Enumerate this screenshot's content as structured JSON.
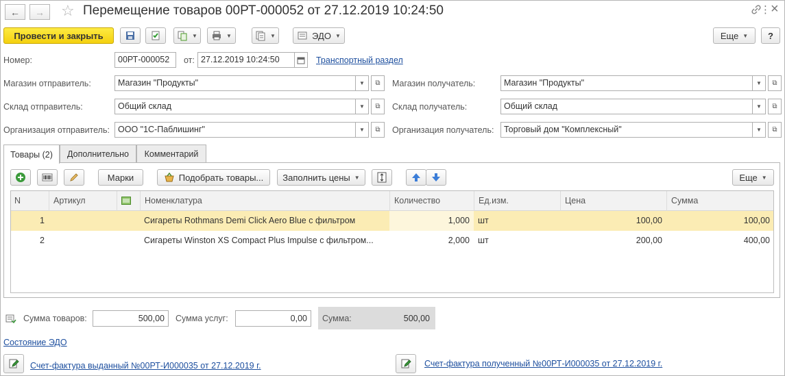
{
  "window": {
    "title": "Перемещение товаров 00РТ-000052 от 27.12.2019 10:24:50",
    "back_glyph": "←",
    "forward_glyph": "→",
    "star_glyph": "☆",
    "link_glyph": "🔗",
    "menu_glyph": "⋮",
    "close_glyph": "×"
  },
  "toolbar": {
    "post_close_label": "Провести и закрыть",
    "edo_label": "ЭДО",
    "more_label": "Еще",
    "help_label": "?"
  },
  "form": {
    "number_label": "Номер:",
    "number_value": "00РТ-000052",
    "date_label": "от:",
    "date_value": "27.12.2019 10:24:50",
    "transport_link": "Транспортный раздел",
    "store_sender_label": "Магазин отправитель:",
    "store_sender_value": "Магазин \"Продукты\"",
    "store_receiver_label": "Магазин получатель:",
    "store_receiver_value": "Магазин \"Продукты\"",
    "warehouse_sender_label": "Склад отправитель:",
    "warehouse_sender_value": "Общий склад",
    "warehouse_receiver_label": "Склад получатель:",
    "warehouse_receiver_value": "Общий склад",
    "org_sender_label": "Организация отправитель:",
    "org_sender_value": "ООО \"1С-Паблишинг\"",
    "org_receiver_label": "Организация получатель:",
    "org_receiver_value": "Торговый дом \"Комплексный\""
  },
  "tabs": [
    {
      "label": "Товары (2)"
    },
    {
      "label": "Дополнительно"
    },
    {
      "label": "Комментарий"
    }
  ],
  "table_toolbar": {
    "marks_label": "Марки",
    "select_goods_label": "Подобрать товары...",
    "fill_prices_label": "Заполнить цены",
    "more_label": "Еще"
  },
  "table": {
    "columns": [
      "N",
      "Артикул",
      "",
      "Номенклатура",
      "Количество",
      "Ед.изм.",
      "Цена",
      "Сумма"
    ],
    "rows": [
      {
        "n": "1",
        "article": "",
        "nomenclature": "Сигареты Rothmans Demi Click Aero Blue с фильтром",
        "qty": "1,000",
        "unit": "шт",
        "price": "100,00",
        "sum": "100,00"
      },
      {
        "n": "2",
        "article": "",
        "nomenclature": "Сигареты Winston XS Compact Plus Impulse с фильтром...",
        "qty": "2,000",
        "unit": "шт",
        "price": "200,00",
        "sum": "400,00"
      }
    ]
  },
  "totals": {
    "goods_sum_label": "Сумма товаров:",
    "goods_sum_value": "500,00",
    "services_sum_label": "Сумма услуг:",
    "services_sum_value": "0,00",
    "total_label": "Сумма:",
    "total_value": "500,00"
  },
  "footer": {
    "edo_state_link": "Состояние ЭДО",
    "invoice_issued_link": "Счет-фактура выданный №00РТ-И000035 от 27.12.2019 г.",
    "invoice_received_link": "Счет-фактура полученный №00РТ-И000035 от 27.12.2019 г."
  },
  "colors": {
    "primary_button": "#f4d00f",
    "selected_row": "#fbecb4",
    "link": "#1c4e9e"
  }
}
